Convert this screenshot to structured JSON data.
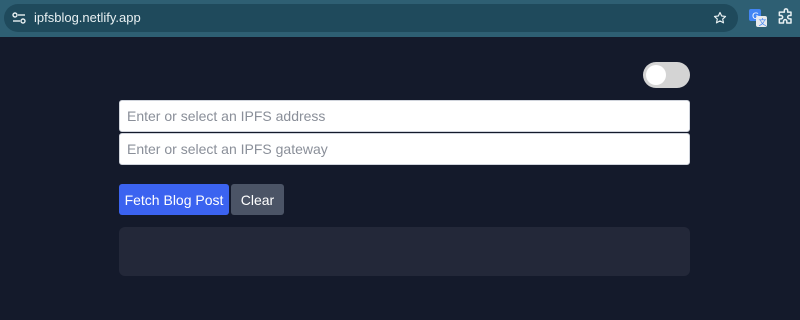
{
  "browser": {
    "url": "ipfsblog.netlify.app",
    "site_info_icon": "tune-icon",
    "bookmark_icon": "star-icon",
    "extensions": [
      "translate-icon",
      "puzzle-icon"
    ]
  },
  "page": {
    "theme_toggle": {
      "state": "off"
    },
    "inputs": {
      "address": {
        "placeholder": "Enter or select an IPFS address",
        "value": ""
      },
      "gateway": {
        "placeholder": "Enter or select an IPFS gateway",
        "value": ""
      }
    },
    "buttons": {
      "fetch": "Fetch Blog Post",
      "clear": "Clear"
    },
    "output": {
      "text": ""
    }
  },
  "colors": {
    "background": "#141a2b",
    "primary_button": "#3b63f0",
    "secondary_button": "#4b5466",
    "panel": "#232839",
    "browser_bar": "#2e5f73"
  }
}
